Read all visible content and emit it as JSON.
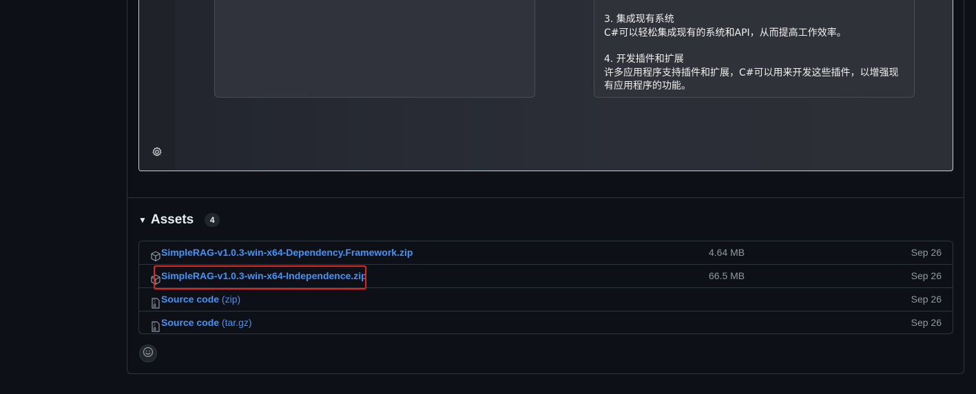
{
  "preview": {
    "lines": [
      {
        "heading": "3. 集成现有系统",
        "body": "C#可以轻松集成现有的系统和API，从而提高工作效率。"
      },
      {
        "heading": "4. 开发插件和扩展",
        "body": "许多应用程序支持插件和扩展，C#可以用来开发这些插件，以增强现有应用程序的功能。"
      }
    ],
    "settings_icon": "gear-icon"
  },
  "assets": {
    "title": "Assets",
    "count": "4",
    "rows": [
      {
        "name": "SimpleRAG-v1.0.3-win-x64-Dependency.Framework.zip",
        "suffix": "",
        "size": "4.64 MB",
        "date": "Sep 26",
        "icon": "package-icon"
      },
      {
        "name": "SimpleRAG-v1.0.3-win-x64-Independence.zip",
        "suffix": "",
        "size": "66.5 MB",
        "date": "Sep 26",
        "icon": "package-icon"
      },
      {
        "name": "Source code",
        "suffix": " (zip)",
        "size": "",
        "date": "Sep 26",
        "icon": "file-zip-icon"
      },
      {
        "name": "Source code",
        "suffix": " (tar.gz)",
        "size": "",
        "date": "Sep 26",
        "icon": "file-zip-icon"
      }
    ]
  },
  "reaction_icon": "smiley-icon",
  "colors": {
    "link": "#4493f8",
    "highlight": "#e0261f",
    "background": "#0d1117"
  }
}
